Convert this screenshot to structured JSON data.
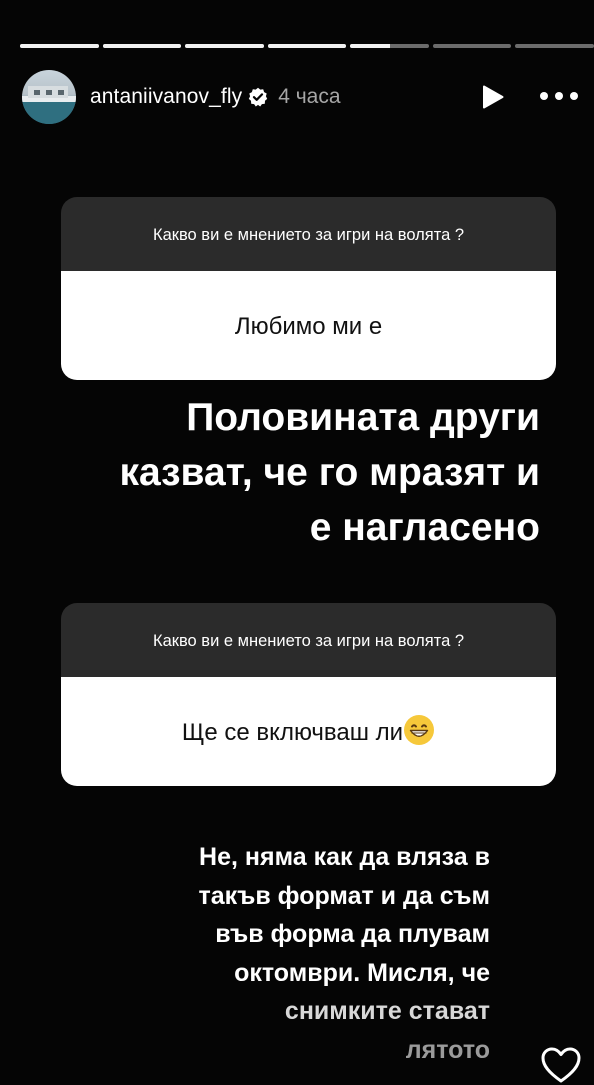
{
  "story": {
    "progress_segments": [
      1,
      1,
      1,
      1,
      0.5,
      0,
      0
    ]
  },
  "header": {
    "username": "antaniivanov_fly",
    "time_ago": "4 часа"
  },
  "questions": [
    {
      "question": "Какво ви е мнението за игри на волята ?",
      "response": "Любимо ми е"
    },
    {
      "question": "Какво ви е мнението за игри на волята ?",
      "response": "Ще се включваш ли"
    }
  ],
  "answers": {
    "first_lines": [
      "Половината други",
      "казват, че го мразят и",
      "е нагласено"
    ],
    "second_lines": [
      "Не, няма как да вляза в",
      "такъв формат и да съм",
      "във форма да плувам",
      "октомври. Мисля, че",
      "снимките стават",
      "лятото"
    ]
  },
  "colors": {
    "background": "#050505",
    "card_header": "#2b2b2b",
    "card_body": "#ffffff"
  },
  "icons": [
    "verified-icon",
    "play-icon",
    "more-icon",
    "grinning-emoji-icon",
    "heart-icon"
  ]
}
